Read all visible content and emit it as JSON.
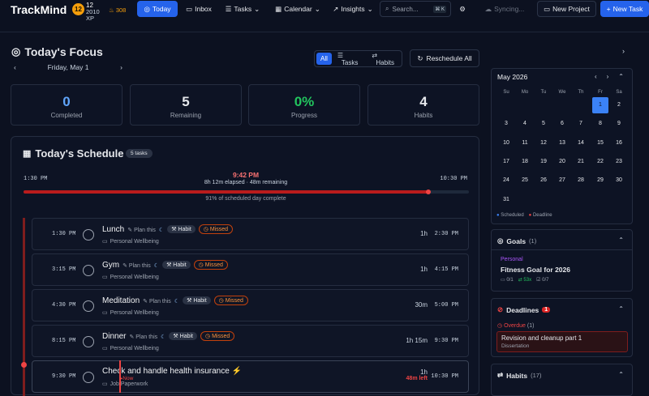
{
  "app": {
    "name": "TrackMind",
    "level": "12",
    "xp_value": "12",
    "xp_sub1": "2010",
    "xp_sub2": "XP",
    "streak": "308"
  },
  "nav": {
    "today": "Today",
    "inbox": "Inbox",
    "tasks": "Tasks",
    "calendar": "Calendar",
    "insights": "Insights",
    "search": "Search...",
    "search_kbd": "⌘ K",
    "syncing": "Syncing...",
    "new_project": "New Project",
    "new_task": "New Task"
  },
  "focus": {
    "title": "Today's Focus",
    "date": "Friday, May 1",
    "filters": [
      "All",
      "Tasks",
      "Habits"
    ],
    "reschedule": "Reschedule All"
  },
  "stats": [
    {
      "value": "0",
      "label": "Completed",
      "color": "#60a5fa"
    },
    {
      "value": "5",
      "label": "Remaining",
      "color": "#f3f4f6"
    },
    {
      "value": "0%",
      "label": "Progress",
      "color": "#22c55e"
    },
    {
      "value": "4",
      "label": "Habits",
      "color": "#f3f4f6"
    }
  ],
  "schedule": {
    "title": "Today's Schedule",
    "count": "5 tasks",
    "start": "1:30 PM",
    "end": "10:30 PM",
    "now": "9:42 PM",
    "elapsed": "8h 12m elapsed · 48m remaining",
    "progress": 0.91,
    "pct_text": "91% of scheduled day complete",
    "tasks": [
      {
        "time": "1:30 PM",
        "name": "Lunch",
        "plan": "Plan this",
        "habit": "Habit",
        "status": "Missed",
        "cat": "Personal Wellbeing",
        "dur": "1h",
        "end": "2:30 PM"
      },
      {
        "time": "3:15 PM",
        "name": "Gym",
        "plan": "Plan this",
        "habit": "Habit",
        "status": "Missed",
        "cat": "Personal Wellbeing",
        "dur": "1h",
        "end": "4:15 PM"
      },
      {
        "time": "4:30 PM",
        "name": "Meditation",
        "plan": "Plan this",
        "habit": "Habit",
        "status": "Missed",
        "cat": "Personal Wellbeing",
        "dur": "30m",
        "end": "5:00 PM"
      },
      {
        "time": "8:15 PM",
        "name": "Dinner",
        "plan": "Plan this",
        "habit": "Habit",
        "status": "Missed",
        "cat": "Personal Wellbeing",
        "dur": "1h 15m",
        "end": "9:30 PM"
      },
      {
        "time": "9:30 PM",
        "name": "Check and handle health insurance",
        "cat": "Job Paperwork",
        "dur": "1h",
        "left": "48m left",
        "end": "10:30 PM",
        "now_label": "Now"
      }
    ]
  },
  "calendar": {
    "month": "May 2026",
    "dow": [
      "Su",
      "Mo",
      "Tu",
      "We",
      "Th",
      "Fr",
      "Sa"
    ],
    "days": [
      "1",
      "2",
      "3",
      "4",
      "5",
      "6",
      "7",
      "8",
      "9",
      "10",
      "11",
      "12",
      "13",
      "14",
      "15",
      "16",
      "17",
      "18",
      "19",
      "20",
      "21",
      "22",
      "23",
      "24",
      "25",
      "26",
      "27",
      "28",
      "29",
      "30",
      "31"
    ],
    "selected": "1",
    "legend_scheduled": "Scheduled",
    "legend_deadline": "Deadline"
  },
  "goals": {
    "title": "Goals",
    "count": "(1)",
    "category": "Personal",
    "name": "Fitness Goal for 2026",
    "m1": "0/1",
    "m2": "53x",
    "m3": "0/7"
  },
  "deadlines": {
    "title": "Deadlines",
    "count": "1",
    "overdue": "Overdue",
    "overdue_count": "(1)",
    "item": "Revision and cleanup part 1",
    "item_sub": "Dissertation"
  },
  "habits": {
    "title": "Habits",
    "count": "(17)"
  }
}
